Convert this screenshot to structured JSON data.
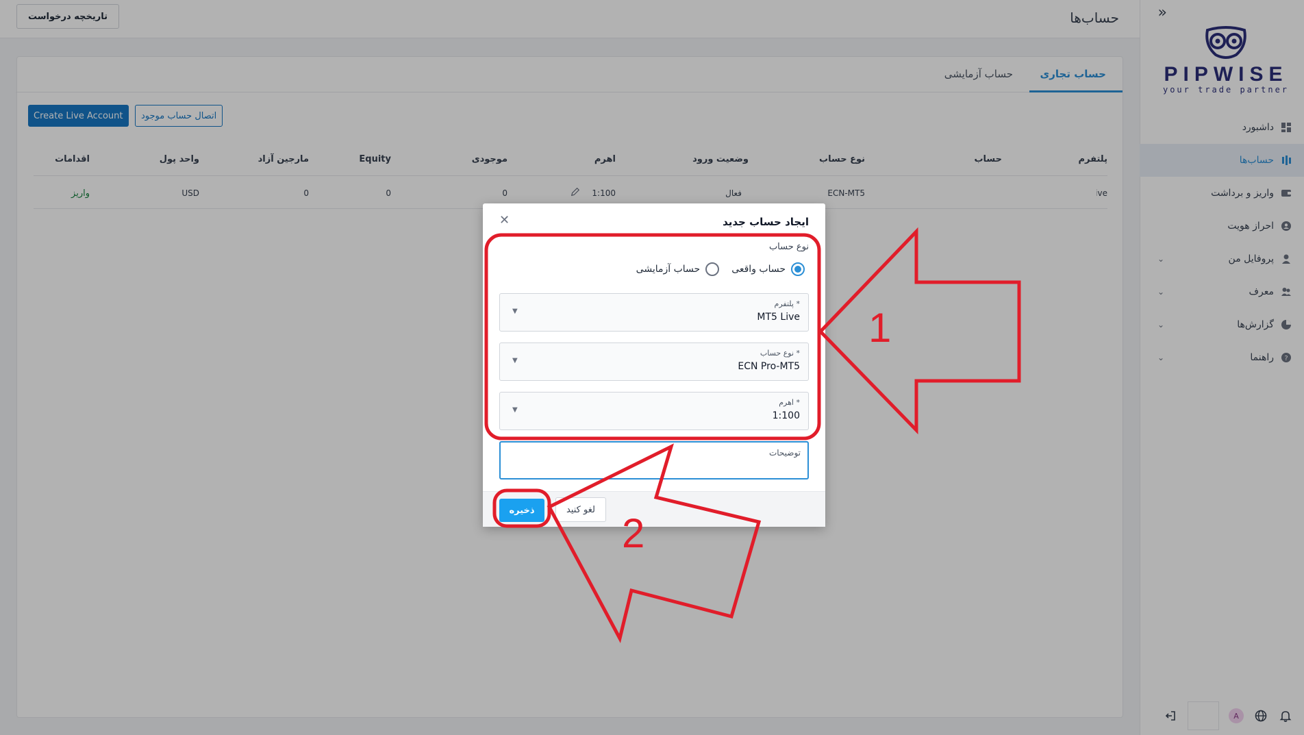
{
  "sidebar": {
    "logo_word": "PIPWISE",
    "logo_tag": "your trade partner",
    "items": [
      {
        "label": "داشبورد",
        "icon": "dashboard-icon",
        "active": false
      },
      {
        "label": "حساب‌ها",
        "icon": "accounts-icon",
        "active": true
      },
      {
        "label": "واریز و برداشت",
        "icon": "wallet-icon",
        "active": false
      },
      {
        "label": "احراز هویت",
        "icon": "identity-icon",
        "active": false
      },
      {
        "label": "پروفایل من",
        "icon": "user-icon",
        "active": false
      },
      {
        "label": "معرف",
        "icon": "referral-icon",
        "active": false
      },
      {
        "label": "گزارش‌ها",
        "icon": "reports-icon",
        "active": false
      },
      {
        "label": "راهنما",
        "icon": "help-icon",
        "active": false
      }
    ],
    "avatar_letter": "A"
  },
  "header": {
    "title": "حساب‌ها",
    "history_button": "تاریخچه درخواست"
  },
  "tabs": {
    "trading": "حساب تجاری",
    "demo": "حساب آزمایشی"
  },
  "actions": {
    "create_live": "Create Live Account",
    "connect_existing": "اتصال حساب موجود"
  },
  "table": {
    "headers": {
      "platform": "پلتفرم",
      "account": "حساب",
      "account_type": "نوع حساب",
      "login_status": "وضعیت ورود",
      "leverage": "اهرم",
      "balance": "موجودی",
      "equity": "Equity",
      "free_margin": "مارجین آزاد",
      "currency": "واحد پول",
      "actions": "اقدامات"
    },
    "row": {
      "platform": "ive",
      "account_type": "ECN-MT5",
      "login_status": "فعال",
      "leverage": "1:100",
      "balance": "0",
      "equity": "0",
      "free_margin": "0",
      "currency": "USD",
      "action": "واریز"
    }
  },
  "modal": {
    "title": "ایجاد حساب جدید",
    "account_kind_label": "نوع حساب",
    "radio_live": "حساب واقعی",
    "radio_demo": "حساب آزمایشی",
    "platform_label": "پلتفرم *",
    "platform_value": "MT5 Live",
    "type_label": "نوع حساب *",
    "type_value": "ECN Pro-MT5",
    "leverage_label": "اهرم *",
    "leverage_value": "1:100",
    "notes_label": "توضیحات",
    "save": "ذخیره",
    "cancel": "لغو کنید"
  },
  "annotations": {
    "step1": "1",
    "step2": "2",
    "color": "#e11d2a"
  }
}
